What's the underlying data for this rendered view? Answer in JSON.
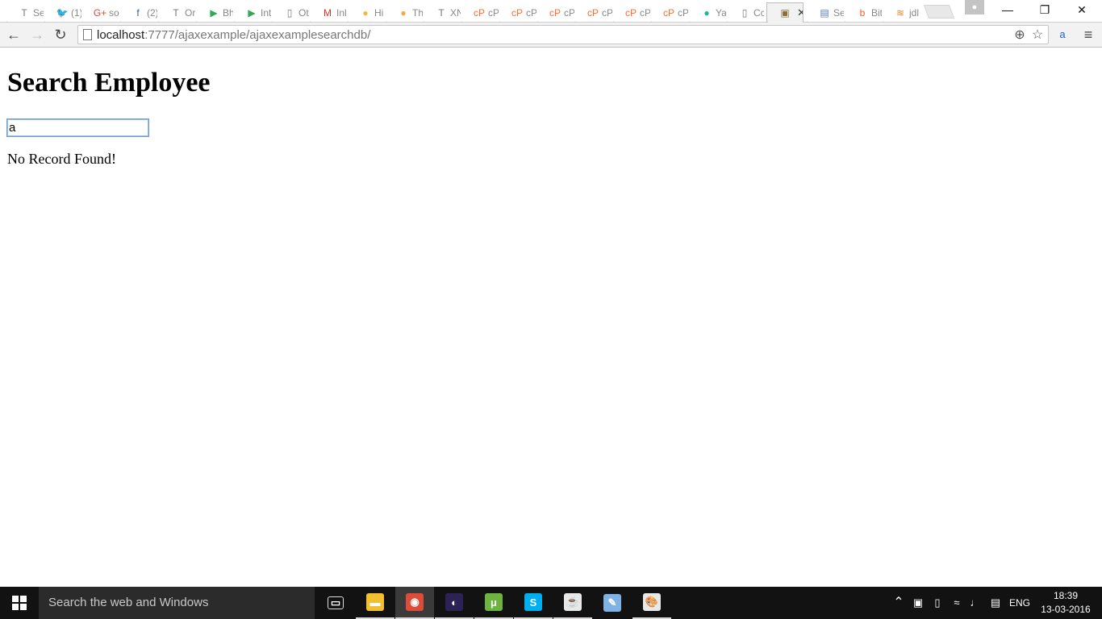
{
  "browser": {
    "tabs": [
      {
        "favicon": "T",
        "favicon_color": "#777777",
        "title": "Se"
      },
      {
        "favicon": "🐦",
        "favicon_color": "#55acee",
        "title": "(1)"
      },
      {
        "favicon": "G+",
        "favicon_color": "#dd4b39",
        "title": "so"
      },
      {
        "favicon": "f",
        "favicon_color": "#3b5998",
        "title": "(2)"
      },
      {
        "favicon": "T",
        "favicon_color": "#777777",
        "title": "Or"
      },
      {
        "favicon": "▶",
        "favicon_color": "#34a853",
        "title": "Bh"
      },
      {
        "favicon": "▶",
        "favicon_color": "#34a853",
        "title": "Int"
      },
      {
        "favicon": "▯",
        "favicon_color": "#777777",
        "title": "Ot"
      },
      {
        "favicon": "M",
        "favicon_color": "#d93025",
        "title": "Inl"
      },
      {
        "favicon": "●",
        "favicon_color": "#f6b63a",
        "title": "Hi"
      },
      {
        "favicon": "●",
        "favicon_color": "#f6a63a",
        "title": "Th"
      },
      {
        "favicon": "T",
        "favicon_color": "#777777",
        "title": "XN"
      },
      {
        "favicon": "cP",
        "favicon_color": "#ff6c2c",
        "title": "cP"
      },
      {
        "favicon": "cP",
        "favicon_color": "#ff6c2c",
        "title": "cP"
      },
      {
        "favicon": "cP",
        "favicon_color": "#ff6c2c",
        "title": "cP"
      },
      {
        "favicon": "cP",
        "favicon_color": "#ff6c2c",
        "title": "cP"
      },
      {
        "favicon": "cP",
        "favicon_color": "#ff6c2c",
        "title": "cP"
      },
      {
        "favicon": "cP",
        "favicon_color": "#ff6c2c",
        "title": "cP"
      },
      {
        "favicon": "●",
        "favicon_color": "#1ab3a6",
        "title": "Ya"
      },
      {
        "favicon": "▯",
        "favicon_color": "#777777",
        "title": "Cc"
      },
      {
        "favicon": "▣",
        "favicon_color": "#8a6d3b",
        "title": "",
        "active": true,
        "close": "✕"
      },
      {
        "favicon": "▤",
        "favicon_color": "#5a7ab0",
        "title": "Se"
      },
      {
        "favicon": "b",
        "favicon_color": "#f05a28",
        "title": "Bit"
      },
      {
        "favicon": "≋",
        "favicon_color": "#f48024",
        "title": "jdl"
      }
    ],
    "profile_icon": "person-icon",
    "window_controls": {
      "minimize": "—",
      "restore": "❐",
      "close": "✕"
    },
    "nav": {
      "back": "←",
      "forward": "→",
      "reload": "↻"
    },
    "address": {
      "host": "localhost",
      "path": ":7777/ajaxexample/ajaxexamplesearchdb/"
    },
    "omnibox_icons": {
      "zoom": "⊕",
      "bookmark": "☆"
    },
    "extension_label": "a",
    "menu_glyph": "≡"
  },
  "page": {
    "heading": "Search Employee",
    "search_value": "a",
    "result_message": "No Record Found!"
  },
  "taskbar": {
    "search_placeholder": "Search the web and Windows",
    "apps": [
      {
        "name": "task-view",
        "glyph": "▭",
        "color": "#121212",
        "running": false,
        "active": false
      },
      {
        "name": "file-explorer",
        "glyph": "▬",
        "color": "#f0c030",
        "running": true,
        "active": false
      },
      {
        "name": "chrome",
        "glyph": "◉",
        "color": "#dd4b39",
        "running": true,
        "active": true
      },
      {
        "name": "eclipse",
        "glyph": "◐",
        "color": "#2c2255",
        "running": true,
        "active": false
      },
      {
        "name": "utorrent",
        "glyph": "μ",
        "color": "#6db33f",
        "running": true,
        "active": false
      },
      {
        "name": "skype",
        "glyph": "S",
        "color": "#00aff0",
        "running": true,
        "active": false
      },
      {
        "name": "java",
        "glyph": "☕",
        "color": "#e8e8e8",
        "running": true,
        "active": false
      },
      {
        "name": "notepad",
        "glyph": "✎",
        "color": "#7fb2e5",
        "running": false,
        "active": false
      },
      {
        "name": "paint",
        "glyph": "🎨",
        "color": "#e8e8e8",
        "running": true,
        "active": false
      }
    ],
    "tray": {
      "chevron": "⌃",
      "language": "ENG",
      "time": "18:39",
      "date": "13-03-2016"
    }
  }
}
